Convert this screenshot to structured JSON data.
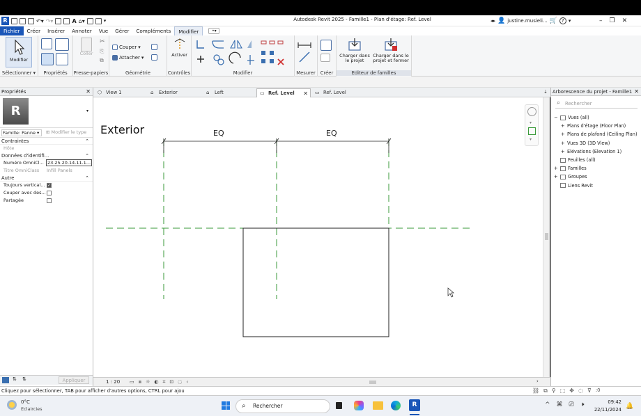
{
  "title_bar": {
    "title": "Autodesk Revit 2025 - Famille1 - Plan d'étage: Ref. Level",
    "user": "justine.musieli...",
    "help": "?"
  },
  "ribbon_tabs": [
    "Fichier",
    "Créer",
    "Insérer",
    "Annoter",
    "Vue",
    "Gérer",
    "Compléments",
    "Modifier"
  ],
  "ribbon": {
    "select": {
      "button": "Modifier",
      "panel": "Sélectionner ▾"
    },
    "properties": {
      "panel": "Propriétés"
    },
    "clipboard": {
      "paste": "Coller",
      "panel": "Presse-papiers"
    },
    "geometry": {
      "cut": "Couper",
      "join": "Attacher",
      "panel": "Géométrie"
    },
    "controls": {
      "activate": "Activer",
      "panel": "Contrôles"
    },
    "modify": {
      "panel": "Modifier"
    },
    "measure": {
      "panel": "Mesurer"
    },
    "create": {
      "panel": "Créer"
    },
    "family_editor": {
      "load_project": "Charger dans le projet",
      "load_close": "Charger dans le projet et fermer",
      "panel": "Editeur de familles"
    }
  },
  "properties_panel": {
    "title": "Propriétés",
    "type_selector": "Famille: Panne",
    "edit_type": "Modifier le type",
    "sections": [
      {
        "label": "Contraintes",
        "rows": [
          {
            "name": "Hôte",
            "value": ""
          }
        ]
      },
      {
        "label": "Données d'identifi...",
        "rows": [
          {
            "name": "Numéro OmniCl...",
            "value": "23.25.20.14.11.1..."
          },
          {
            "name": "Titre OmniClass",
            "value": "Infill Panels"
          }
        ]
      },
      {
        "label": "Autre",
        "rows": [
          {
            "name": "Toujours vertical...",
            "checked": true
          },
          {
            "name": "Couper avec des...",
            "checked": false
          },
          {
            "name": "Partagée",
            "checked": false
          }
        ]
      }
    ],
    "apply": "Appliquer"
  },
  "doc_tabs": [
    {
      "label": "View 1",
      "active": false,
      "closable": false
    },
    {
      "label": "Exterior",
      "active": false,
      "closable": false
    },
    {
      "label": "Left",
      "active": false,
      "closable": false
    },
    {
      "label": "Ref. Level",
      "active": true,
      "closable": true
    },
    {
      "label": "Ref. Level",
      "active": false,
      "closable": false
    }
  ],
  "canvas": {
    "view_label": "Exterior",
    "dim_left": "EQ",
    "dim_right": "EQ"
  },
  "view_bar": {
    "scale": "1 : 20"
  },
  "project_browser": {
    "title": "Arborescence du projet - Famille1",
    "search_placeholder": "Rechercher",
    "items": [
      {
        "label": "Vues (all)",
        "level": 0,
        "toggle": "−"
      },
      {
        "label": "Plans d'étage (Floor Plan)",
        "level": 1,
        "toggle": "+"
      },
      {
        "label": "Plans de plafond (Ceiling Plan)",
        "level": 1,
        "toggle": "+"
      },
      {
        "label": "Vues 3D (3D View)",
        "level": 1,
        "toggle": "+"
      },
      {
        "label": "Elévations (Elevation 1)",
        "level": 1,
        "toggle": "+"
      },
      {
        "label": "Feuilles (all)",
        "level": 0,
        "toggle": ""
      },
      {
        "label": "Familles",
        "level": 0,
        "toggle": "+"
      },
      {
        "label": "Groupes",
        "level": 0,
        "toggle": "+"
      },
      {
        "label": "Liens Revit",
        "level": 0,
        "toggle": ""
      }
    ]
  },
  "status": {
    "message": "Cliquez pour sélectionner, TAB pour afficher d'autres options,  CTRL pour ajou",
    "selection_count": ":0"
  },
  "taskbar": {
    "weather_temp": "0°C",
    "weather_desc": "Eclaircies",
    "search": "Rechercher",
    "time": "09:42",
    "date": "22/11/2024"
  },
  "colors": {
    "revit_blue": "#1a56b8",
    "ref_plane_green": "#3a9a3a",
    "canvas": "#ffffff"
  }
}
